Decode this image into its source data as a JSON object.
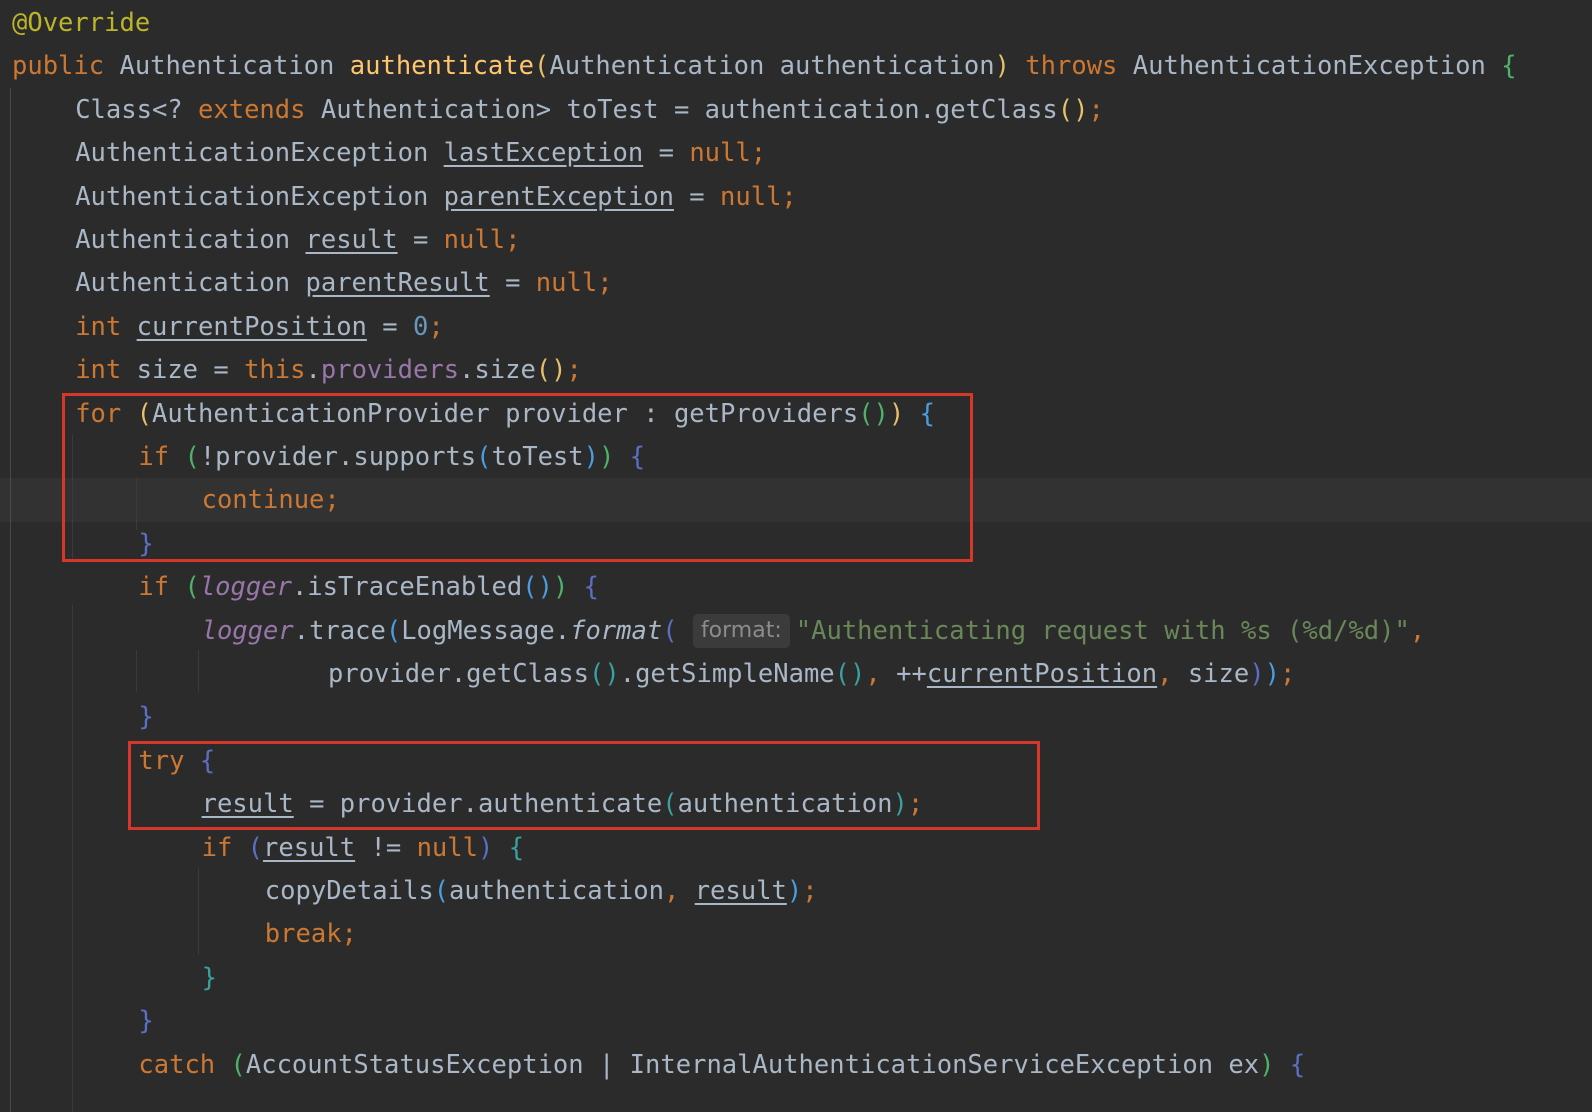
{
  "editor": {
    "background": "#2b2b2b",
    "highlight_box_color": "#d7372a",
    "lines": [
      {
        "tokens": [
          [
            "ann",
            "@Override"
          ]
        ]
      },
      {
        "tokens": [
          [
            "kw",
            "public "
          ],
          [
            "t",
            "Authentication "
          ],
          [
            "fn",
            "authenticate"
          ],
          [
            "p-y",
            "("
          ],
          [
            "t",
            "Authentication authentication"
          ],
          [
            "p-y",
            ")"
          ],
          [
            "t",
            " "
          ],
          [
            "kw",
            "throws "
          ],
          [
            "t",
            "AuthenticationException "
          ],
          [
            "p-g",
            "{"
          ]
        ]
      },
      {
        "indent": 1,
        "tokens": [
          [
            "t",
            "Class<? "
          ],
          [
            "kw",
            "extends "
          ],
          [
            "t",
            "Authentication> toTest = authentication.getClass"
          ],
          [
            "p-y",
            "()"
          ],
          [
            "kw",
            ";"
          ]
        ]
      },
      {
        "indent": 1,
        "tokens": [
          [
            "t",
            "AuthenticationException "
          ],
          [
            "u",
            "lastException"
          ],
          [
            "t",
            " = "
          ],
          [
            "kw",
            "null;"
          ]
        ]
      },
      {
        "indent": 1,
        "tokens": [
          [
            "t",
            "AuthenticationException "
          ],
          [
            "u",
            "parentException"
          ],
          [
            "t",
            " = "
          ],
          [
            "kw",
            "null;"
          ]
        ]
      },
      {
        "indent": 1,
        "tokens": [
          [
            "t",
            "Authentication "
          ],
          [
            "u",
            "result"
          ],
          [
            "t",
            " = "
          ],
          [
            "kw",
            "null;"
          ]
        ]
      },
      {
        "indent": 1,
        "tokens": [
          [
            "t",
            "Authentication "
          ],
          [
            "u",
            "parentResult"
          ],
          [
            "t",
            " = "
          ],
          [
            "kw",
            "null;"
          ]
        ]
      },
      {
        "indent": 1,
        "tokens": [
          [
            "kw",
            "int "
          ],
          [
            "u",
            "currentPosition"
          ],
          [
            "t",
            " = "
          ],
          [
            "num",
            "0"
          ],
          [
            "kw",
            ";"
          ]
        ]
      },
      {
        "indent": 1,
        "tokens": [
          [
            "kw",
            "int "
          ],
          [
            "t",
            "size = "
          ],
          [
            "kw",
            "this"
          ],
          [
            "t",
            "."
          ],
          [
            "fld",
            "providers"
          ],
          [
            "t",
            ".size"
          ],
          [
            "p-y",
            "()"
          ],
          [
            "kw",
            ";"
          ]
        ]
      },
      {
        "indent": 1,
        "tokens": [
          [
            "kw",
            "for "
          ],
          [
            "p-y",
            "("
          ],
          [
            "t",
            "AuthenticationProvider provider : getProviders"
          ],
          [
            "p-g",
            "()"
          ],
          [
            "p-y",
            ")"
          ],
          [
            "t",
            " "
          ],
          [
            "p-b",
            "{"
          ]
        ]
      },
      {
        "indent": 2,
        "tokens": [
          [
            "kw",
            "if "
          ],
          [
            "p-g",
            "("
          ],
          [
            "t",
            "!provider.supports"
          ],
          [
            "p-b",
            "("
          ],
          [
            "t",
            "toTest"
          ],
          [
            "p-b",
            ")"
          ],
          [
            "p-g",
            ")"
          ],
          [
            "t",
            " "
          ],
          [
            "p-v",
            "{"
          ]
        ]
      },
      {
        "indent": 3,
        "current": true,
        "tokens": [
          [
            "kw",
            "continue;"
          ]
        ]
      },
      {
        "indent": 2,
        "tokens": [
          [
            "p-v",
            "}"
          ]
        ]
      },
      {
        "indent": 2,
        "tokens": [
          [
            "kw",
            "if "
          ],
          [
            "p-g",
            "("
          ],
          [
            "sfld",
            "logger"
          ],
          [
            "t",
            ".isTraceEnabled"
          ],
          [
            "p-b",
            "()"
          ],
          [
            "p-g",
            ")"
          ],
          [
            "t",
            " "
          ],
          [
            "p-v",
            "{"
          ]
        ]
      },
      {
        "indent": 3,
        "tokens": [
          [
            "sfld",
            "logger"
          ],
          [
            "t",
            ".trace"
          ],
          [
            "p-b",
            "("
          ],
          [
            "t",
            "LogMessage."
          ],
          [
            "smeth",
            "format"
          ],
          [
            "p-v",
            "("
          ],
          [
            "t",
            " "
          ],
          [
            "hint",
            "format:"
          ],
          [
            "str",
            "\"Authenticating request with %s (%d/%d)\""
          ],
          [
            "kw",
            ","
          ]
        ]
      },
      {
        "indent": 5,
        "tokens": [
          [
            "t",
            "provider.getClass"
          ],
          [
            "p-t",
            "()"
          ],
          [
            "t",
            ".getSimpleName"
          ],
          [
            "p-t",
            "()"
          ],
          [
            "kw",
            ", "
          ],
          [
            "t",
            "++"
          ],
          [
            "u",
            "currentPosition"
          ],
          [
            "kw",
            ", "
          ],
          [
            "t",
            "size"
          ],
          [
            "p-v",
            ")"
          ],
          [
            "p-b",
            ")"
          ],
          [
            "kw",
            ";"
          ]
        ]
      },
      {
        "indent": 2,
        "tokens": [
          [
            "p-v",
            "}"
          ]
        ]
      },
      {
        "indent": 2,
        "tokens": [
          [
            "kw",
            "try "
          ],
          [
            "p-v",
            "{"
          ]
        ]
      },
      {
        "indent": 3,
        "tokens": [
          [
            "u",
            "result"
          ],
          [
            "t",
            " = provider.authenticate"
          ],
          [
            "p-t",
            "("
          ],
          [
            "t",
            "authentication"
          ],
          [
            "p-t",
            ")"
          ],
          [
            "kw",
            ";"
          ]
        ]
      },
      {
        "indent": 3,
        "tokens": [
          [
            "kw",
            "if "
          ],
          [
            "p-v",
            "("
          ],
          [
            "u",
            "result"
          ],
          [
            "t",
            " != "
          ],
          [
            "kw",
            "null"
          ],
          [
            "p-v",
            ")"
          ],
          [
            "t",
            " "
          ],
          [
            "p-t",
            "{"
          ]
        ]
      },
      {
        "indent": 4,
        "tokens": [
          [
            "t",
            "copyDetails"
          ],
          [
            "p-b",
            "("
          ],
          [
            "t",
            "authentication"
          ],
          [
            "kw",
            ", "
          ],
          [
            "u",
            "result"
          ],
          [
            "p-b",
            ")"
          ],
          [
            "kw",
            ";"
          ]
        ]
      },
      {
        "indent": 4,
        "tokens": [
          [
            "kw",
            "break;"
          ]
        ]
      },
      {
        "indent": 3,
        "tokens": [
          [
            "p-t",
            "}"
          ]
        ]
      },
      {
        "indent": 2,
        "tokens": [
          [
            "p-v",
            "}"
          ]
        ]
      },
      {
        "indent": 2,
        "tokens": [
          [
            "kw",
            "catch "
          ],
          [
            "p-g",
            "("
          ],
          [
            "t",
            "AccountStatusException | InternalAuthenticationServiceException ex"
          ],
          [
            "p-g",
            ")"
          ],
          [
            "t",
            " "
          ],
          [
            "p-v",
            "{"
          ]
        ]
      }
    ]
  }
}
